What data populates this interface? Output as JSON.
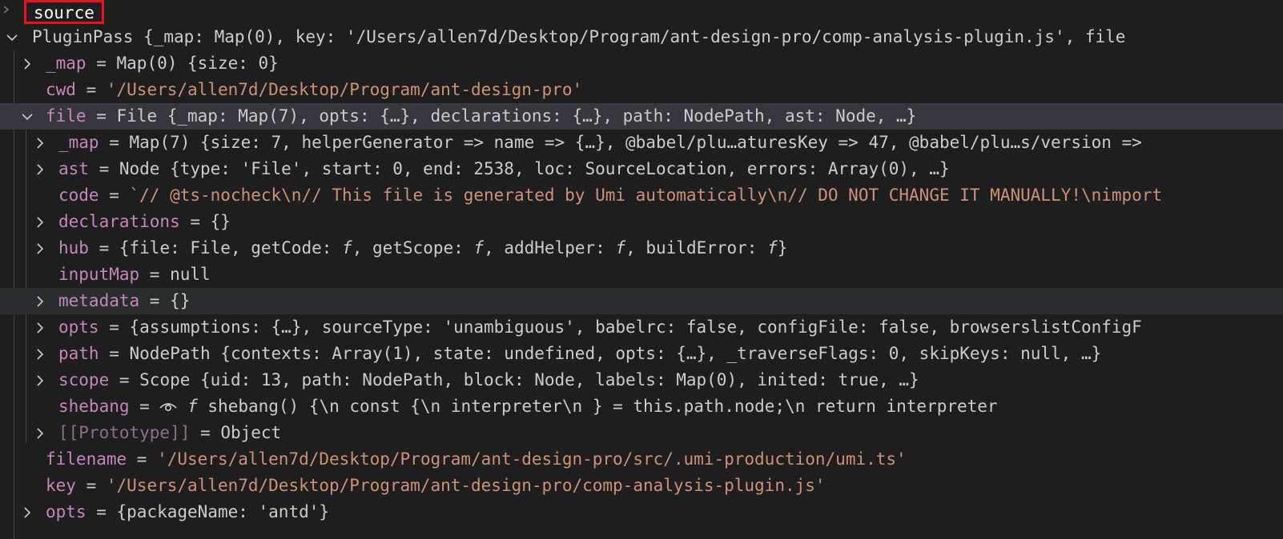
{
  "header": {
    "label": "source"
  },
  "colors": {
    "background": "#1e1e1e",
    "selected_row": "#37373d",
    "property_key": "#c586c0",
    "string_value": "#ce9178",
    "highlight_box": "#e8141c"
  },
  "rows": {
    "pluginpass": {
      "text": "PluginPass {_map: Map(0), key: '/Users/allen7d/Desktop/Program/ant-design-pro/comp-analysis-plugin.js', file"
    },
    "map": {
      "key": "_map",
      "op": " = ",
      "value": "Map(0) {size: 0}"
    },
    "cwd": {
      "key": "cwd",
      "op": " = ",
      "value": "'/Users/allen7d/Desktop/Program/ant-design-pro'"
    },
    "file": {
      "key": "file",
      "op": " = ",
      "value": "File {_map: Map(7), opts: {…}, declarations: {…}, path: NodePath, ast: Node, …}"
    },
    "file_map": {
      "key": "_map",
      "op": " = ",
      "value": "Map(7) {size: 7, helperGenerator => name => {…}, @babel/plu…aturesKey => 47, @babel/plu…s/version =>"
    },
    "ast": {
      "key": "ast",
      "op": " = ",
      "value": "Node {type: 'File', start: 0, end: 2538, loc: SourceLocation, errors: Array(0), …}"
    },
    "code": {
      "key": "code",
      "op": " = ",
      "value": "`// @ts-nocheck\\n// This file is generated by Umi automatically\\n// DO NOT CHANGE IT MANUALLY!\\nimport"
    },
    "declarations": {
      "key": "declarations",
      "op": " = ",
      "value": "{}"
    },
    "hub": {
      "key": "hub",
      "op": " = ",
      "value_a": "{file: File, getCode: ",
      "f1": "f",
      "value_b": ", getScope: ",
      "f2": "f",
      "value_c": ", addHelper: ",
      "f3": "f",
      "value_d": ", buildError: ",
      "f4": "f",
      "value_e": "}"
    },
    "inputmap": {
      "key": "inputMap",
      "op": " = ",
      "value": "null"
    },
    "metadata": {
      "key": "metadata",
      "op": " = ",
      "value": "{}"
    },
    "opts": {
      "key": "opts",
      "op": " = ",
      "value": "{assumptions: {…}, sourceType: 'unambiguous', babelrc: false, configFile: false, browserslistConfigF"
    },
    "path": {
      "key": "path",
      "op": " = ",
      "value": "NodePath {contexts: Array(1), state: undefined, opts: {…}, _traverseFlags: 0, skipKeys: null, …}"
    },
    "scope": {
      "key": "scope",
      "op": " = ",
      "value": "Scope {uid: 13, path: NodePath, block: Node, labels: Map(0), inited: true, …}"
    },
    "shebang": {
      "key": "shebang",
      "op": " = ",
      "eye": "👁",
      "fn": "f",
      "value": " shebang() {\\n    const {\\n      interpreter\\n    } = this.path.node;\\n    return interpreter"
    },
    "prototype": {
      "key": "[[Prototype]]",
      "op": " = ",
      "value": "Object"
    },
    "filename": {
      "key": "filename",
      "op": " = ",
      "value": "'/Users/allen7d/Desktop/Program/ant-design-pro/src/.umi-production/umi.ts'"
    },
    "key": {
      "key": "key",
      "op": " = ",
      "value": "'/Users/allen7d/Desktop/Program/ant-design-pro/comp-analysis-plugin.js'"
    },
    "root_opts": {
      "key": "opts",
      "op": " = ",
      "value": "{packageName: 'antd'}"
    }
  }
}
